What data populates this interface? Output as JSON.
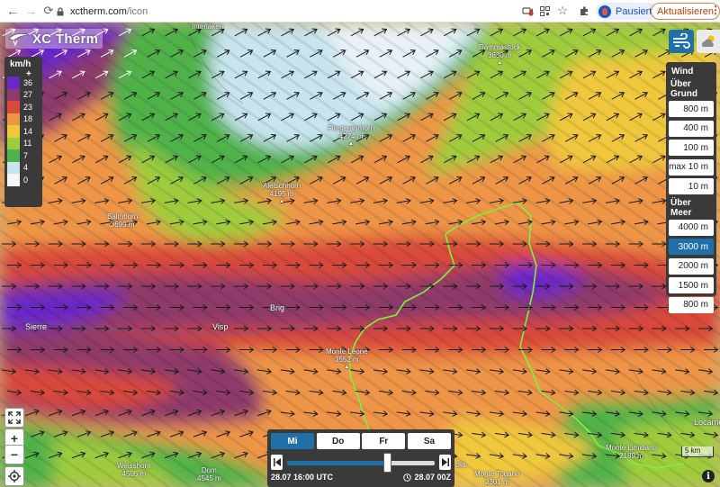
{
  "browser": {
    "url_host": "xctherm.com",
    "url_path": "/icon",
    "profile_label": "Pausiert",
    "update_label": "Aktualisieren"
  },
  "app": {
    "title": "XC Therm"
  },
  "legend": {
    "unit": "km/h",
    "plus": "+",
    "items": [
      {
        "label": "36",
        "color": "#6a28c8"
      },
      {
        "label": "27",
        "color": "#8e3a6b"
      },
      {
        "label": "23",
        "color": "#d94a3a"
      },
      {
        "label": "18",
        "color": "#ee9546"
      },
      {
        "label": "14",
        "color": "#f0c83c"
      },
      {
        "label": "11",
        "color": "#9fcc3c"
      },
      {
        "label": "7",
        "color": "#4fb24a"
      },
      {
        "label": "4",
        "color": "#c8e4ef"
      },
      {
        "label": "0",
        "color": "#f4f7fa"
      }
    ]
  },
  "wind_panel": {
    "title": "Wind",
    "ground_title": "Über Grund",
    "ground_levels": [
      "800 m",
      "400 m",
      "100 m",
      "max 10 m",
      "10 m"
    ],
    "sea_title": "Über Meer",
    "sea_levels": [
      "4000 m",
      "3000 m",
      "2000 m",
      "1500 m",
      "800 m"
    ],
    "selected": "3000 m"
  },
  "places": {
    "interlaken": "Interlaken",
    "dammastock": "Dammastock",
    "dammastock_alt": "3630 m",
    "finsteraarhorn": "Finsteraarhorn",
    "finsteraarhorn_alt": "4274 m",
    "aletschhorn": "Aletschhorn",
    "aletschhorn_alt": "4195 m",
    "balmhorn": "Balmhorn",
    "balmhorn_alt": "3699 m",
    "brig": "Brig",
    "sierre": "Sierre",
    "visp": "Visp",
    "monte_leone": "Monte Leone",
    "monte_leone_alt": "3552 m",
    "weisshorn": "Weisshorn",
    "weisshorn_alt": "4505 m",
    "dom": "Dom",
    "dom_alt": "4545 m",
    "ola": "ola",
    "monte_togano": "Monte Togano",
    "monte_togano_alt": "2301 m",
    "monte_limidario": "Monte Limidario",
    "monte_limidario_alt": "2189 m",
    "locarno": "Locarno"
  },
  "time": {
    "days": [
      "Mi",
      "Do",
      "Fr",
      "Sa"
    ],
    "selected_day": "Mi",
    "start_label": "28.07 16:00 UTC",
    "model_label": "28.07 00Z",
    "slider_position": 0.68
  },
  "scale_label": "5 km",
  "icons": {
    "zoom_in": "+",
    "zoom_out": "−",
    "info": "i"
  }
}
